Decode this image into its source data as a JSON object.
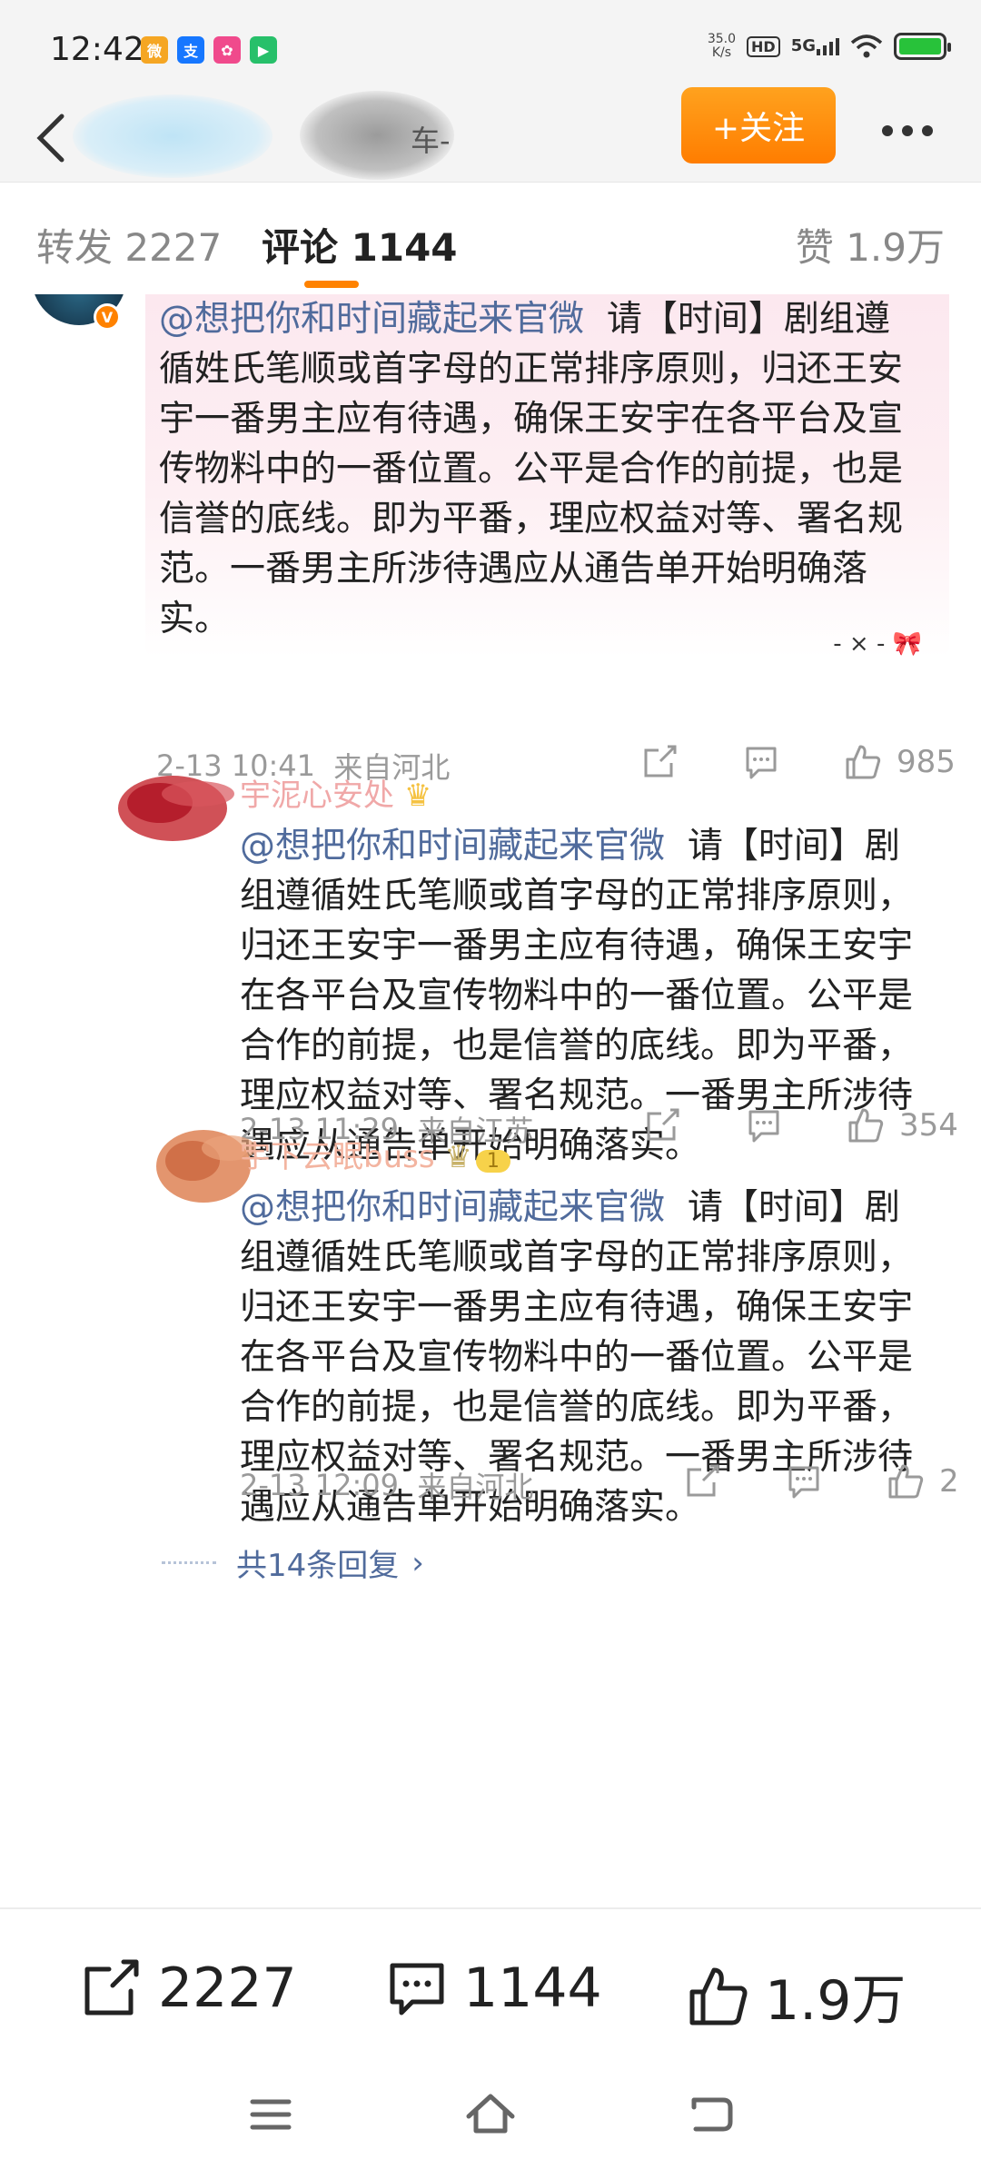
{
  "status_bar": {
    "time": "12:42",
    "apps": [
      {
        "icon": "weibo-app-icon",
        "color": "#f5a623",
        "glyph": "微"
      },
      {
        "icon": "alipay-app-icon",
        "color": "#1677ff",
        "glyph": "支"
      },
      {
        "icon": "pink-app-icon",
        "color": "#f04a8c",
        "glyph": "✿"
      },
      {
        "icon": "video-app-icon",
        "color": "#27c06a",
        "glyph": "▶"
      }
    ],
    "speed_value": "35.0",
    "speed_unit": "K/s",
    "hd": "HD",
    "network": "5G",
    "battery_level": 1.0,
    "battery_color": "#28c23a"
  },
  "header": {
    "username_tail": "车-",
    "follow_label": "+关注"
  },
  "tabs": {
    "repost": "转发 2227",
    "comment": "评论 1144",
    "like": "赞 1.9万",
    "accent": "#ff8200"
  },
  "comments": {
    "main": {
      "mention": "@想把你和时间藏起来官微",
      "body": "请【时间】剧组遵循姓氏笔顺或首字母的正常排序原则，归还王安宇一番男主应有待遇，确保王安宇在各平台及宣传物料中的一番位置。公平是合作的前提，也是信誉的底线。即为平番，理应权益对等、署名规范。一番男主所涉待遇应从通告单开始明确落实。",
      "time": "2-13 10:41",
      "location": "来自河北",
      "likes": "985",
      "deco": "- × -"
    },
    "reply1": {
      "name": "宇泥心安处",
      "mention": "@想把你和时间藏起来官微",
      "body": "请【时间】剧组遵循姓氏笔顺或首字母的正常排序原则，归还王安宇一番男主应有待遇，确保王安宇在各平台及宣传物料中的一番位置。公平是合作的前提，也是信誉的底线。即为平番，理应权益对等、署名规范。一番男主所涉待遇应从通告单开始明确落实。",
      "time": "2-13 11:29",
      "location": "来自江苏",
      "likes": "354"
    },
    "reply2": {
      "name": "宇下云眠buss",
      "mention": "@想把你和时间藏起来官微",
      "body": "请【时间】剧组遵循姓氏笔顺或首字母的正常排序原则，归还王安宇一番男主应有待遇，确保王安宇在各平台及宣传物料中的一番位置。公平是合作的前提，也是信誉的底线。即为平番，理应权益对等、署名规范。一番男主所涉待遇应从通告单开始明确落实。",
      "time": "2-13 12:09",
      "location": "来自河北",
      "likes": "2"
    },
    "more_replies": "共14条回复",
    "more_chevron": "›"
  },
  "bottom_bar": {
    "reposts": "2227",
    "comments": "1144",
    "likes": "1.9万"
  },
  "colors": {
    "mention": "#506b9c",
    "meta": "#9a9a9a",
    "follow_gradient_start": "#ffa21e",
    "follow_gradient_end": "#ff7d00"
  }
}
